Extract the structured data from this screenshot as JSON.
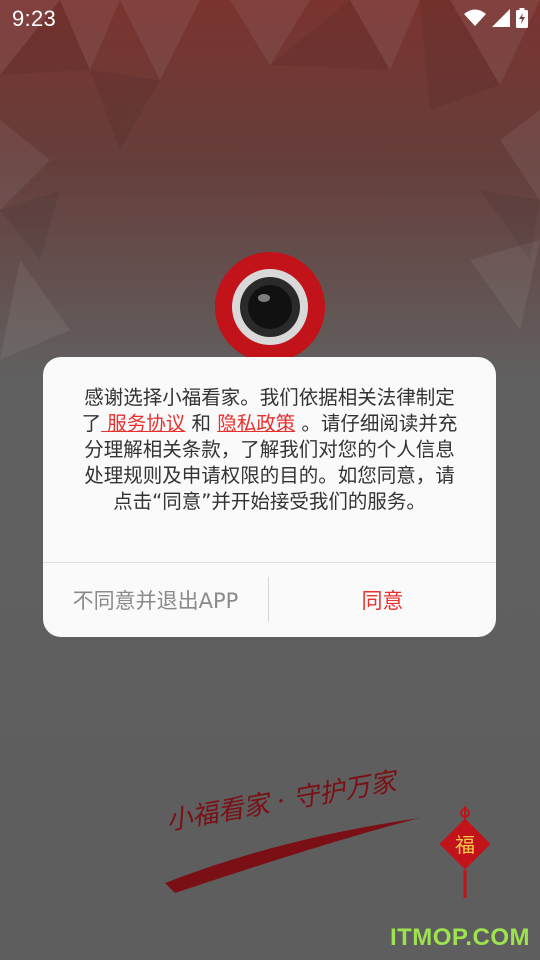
{
  "status_bar": {
    "time": "9:23",
    "icons": [
      "wifi-icon",
      "cell-signal-icon",
      "battery-charging-icon"
    ]
  },
  "app": {
    "logo_icon": "camera-lens-icon",
    "slogan_art": "小福看家 · 守护万家",
    "seal_text": "福"
  },
  "dialog": {
    "text_before": "感谢选择小福看家。我们依据相关法律制定了",
    "link_service": " 服务协议",
    "text_and": " 和 ",
    "link_privacy": "隐私政策",
    "text_after": " 。请仔细阅读并充分理解相关条款，了解我们对您的个人信息处理规则及申请权限的目的。如您同意，请点击“同意”并开始接受我们的服务。",
    "decline_label": "不同意并退出APP",
    "agree_label": "同意"
  },
  "watermark": "ITMOP.COM",
  "colors": {
    "accent": "#e8312f",
    "brand_red": "#c2121a",
    "dark_red": "#7a1015",
    "watermark": "#9de24f"
  }
}
